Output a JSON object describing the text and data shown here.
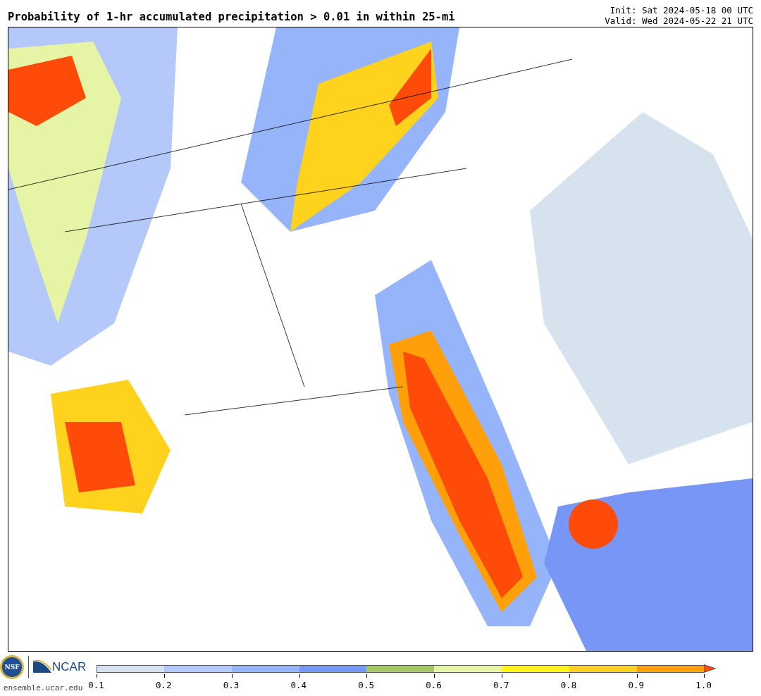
{
  "title": "Probability of 1-hr accumulated precipitation > 0.01 in within 25-mi",
  "init": "Init: Sat 2024-05-18 00 UTC",
  "valid": "Valid: Wed 2024-05-22 21 UTC",
  "logos": {
    "nsf": "NSF",
    "ncar": "NCAR",
    "url": "ensemble.ucar.edu"
  },
  "colorbar": {
    "bins": [
      {
        "kind": "bin",
        "color": "#d6e2ed"
      },
      {
        "kind": "bin",
        "color": "#b4c8fa"
      },
      {
        "kind": "bin",
        "color": "#96b4fa"
      },
      {
        "kind": "bin",
        "color": "#7896f5"
      },
      {
        "kind": "bin",
        "color": "#a5c864"
      },
      {
        "kind": "bin",
        "color": "#e6f5a5"
      },
      {
        "kind": "bin",
        "color": "#fff514"
      },
      {
        "kind": "bin",
        "color": "#ffd21e"
      },
      {
        "kind": "bin",
        "color": "#ffa00a"
      },
      {
        "kind": "arrow",
        "color": "#ff4b0a"
      }
    ],
    "ticks": [
      "0.1",
      "0.2",
      "0.3",
      "0.4",
      "0.5",
      "0.6",
      "0.7",
      "0.8",
      "0.9",
      "1.0"
    ]
  }
}
